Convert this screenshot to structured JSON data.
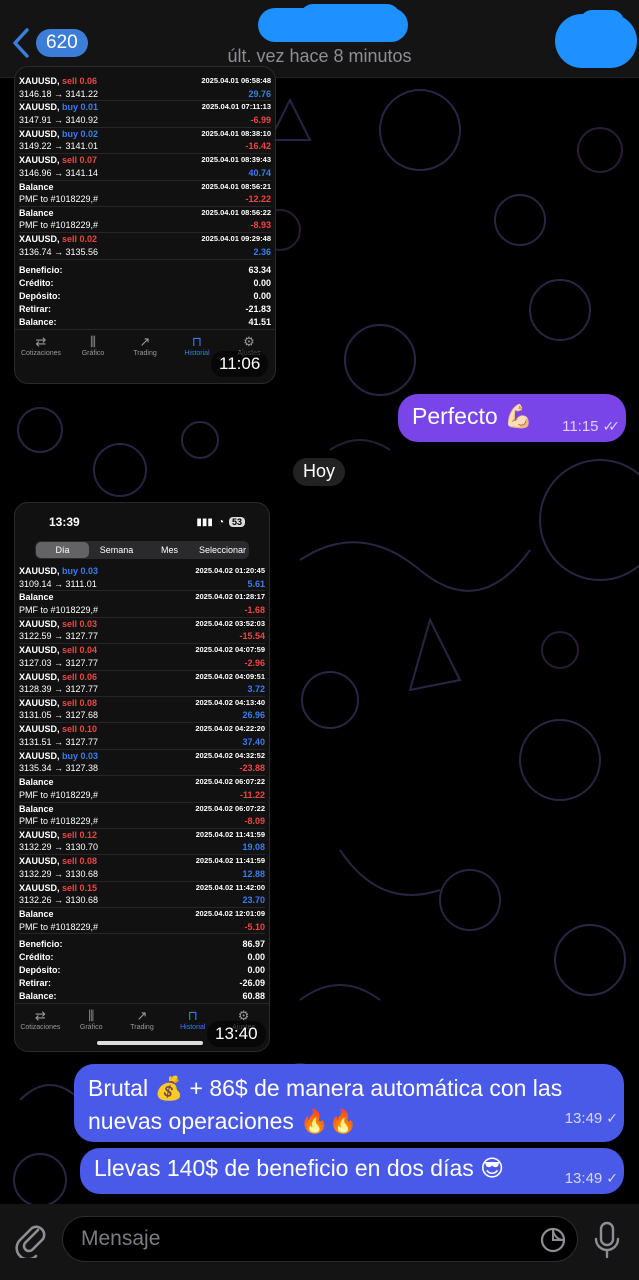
{
  "header": {
    "back_count": "620",
    "status": "últ. vez hace 8 minutos"
  },
  "shot1": {
    "trades": [
      {
        "sym": "XAUUSD,",
        "act": "sell 0.06",
        "type": "sell",
        "time": "2025.04.01 06:58:48",
        "prices": "3146.18 → 3141.22",
        "profit": "29.76"
      },
      {
        "sym": "XAUUSD,",
        "act": "buy 0.01",
        "type": "buy",
        "time": "2025.04.01 07:11:13",
        "prices": "3147.91 → 3140.92",
        "profit": "-6.99"
      },
      {
        "sym": "XAUUSD,",
        "act": "buy 0.02",
        "type": "buy",
        "time": "2025.04.01 08:38:10",
        "prices": "3149.22 → 3141.01",
        "profit": "-16.42"
      },
      {
        "sym": "XAUUSD,",
        "act": "sell 0.07",
        "type": "sell",
        "time": "2025.04.01 08:39:43",
        "prices": "3146.96 → 3141.14",
        "profit": "40.74"
      },
      {
        "sym": "Balance",
        "act": "",
        "type": "",
        "time": "2025.04.01 08:56:21",
        "prices": "PMF to #1018229,#",
        "profit": "-12.22"
      },
      {
        "sym": "Balance",
        "act": "",
        "type": "",
        "time": "2025.04.01 08:56:22",
        "prices": "PMF to #1018229,#",
        "profit": "-8.93"
      },
      {
        "sym": "XAUUSD,",
        "act": "sell 0.02",
        "type": "sell",
        "time": "2025.04.01 09:29:48",
        "prices": "3136.74 → 3135.56",
        "profit": "2.36"
      }
    ],
    "summary": [
      {
        "label": "Beneficio:",
        "value": "63.34"
      },
      {
        "label": "Crédito:",
        "value": "0.00"
      },
      {
        "label": "Depósito:",
        "value": "0.00"
      },
      {
        "label": "Retirar:",
        "value": "-21.83"
      },
      {
        "label": "Balance:",
        "value": "41.51"
      }
    ],
    "time": "11:06"
  },
  "tabs": [
    {
      "label": "Cotizaciones",
      "icon": "swap-arrows-icon"
    },
    {
      "label": "Gráfico",
      "icon": "candles-icon"
    },
    {
      "label": "Trading",
      "icon": "trend-icon"
    },
    {
      "label": "Historial",
      "icon": "inbox-icon"
    },
    {
      "label": "Ajustes",
      "icon": "gear-icon"
    }
  ],
  "perfecto": {
    "text": "Perfecto 💪🏻",
    "time": "11:15"
  },
  "date_divider": "Hoy",
  "shot2": {
    "clock": "13:39",
    "battery": "53",
    "segments": [
      "Día",
      "Semana",
      "Mes",
      "Seleccionar"
    ],
    "trades": [
      {
        "sym": "XAUUSD,",
        "act": "buy 0.03",
        "type": "buy",
        "time": "2025.04.02 01:20:45",
        "prices": "3109.14 → 3111.01",
        "profit": "5.61"
      },
      {
        "sym": "Balance",
        "act": "",
        "type": "",
        "time": "2025.04.02 01:28:17",
        "prices": "PMF to #1018229,#",
        "profit": "-1.68"
      },
      {
        "sym": "XAUUSD,",
        "act": "sell 0.03",
        "type": "sell",
        "time": "2025.04.02 03:52:03",
        "prices": "3122.59 → 3127.77",
        "profit": "-15.54"
      },
      {
        "sym": "XAUUSD,",
        "act": "sell 0.04",
        "type": "sell",
        "time": "2025.04.02 04:07:59",
        "prices": "3127.03 → 3127.77",
        "profit": "-2.96"
      },
      {
        "sym": "XAUUSD,",
        "act": "sell 0.06",
        "type": "sell",
        "time": "2025.04.02 04:09:51",
        "prices": "3128.39 → 3127.77",
        "profit": "3.72"
      },
      {
        "sym": "XAUUSD,",
        "act": "sell 0.08",
        "type": "sell",
        "time": "2025.04.02 04:13:40",
        "prices": "3131.05 → 3127.68",
        "profit": "26.96"
      },
      {
        "sym": "XAUUSD,",
        "act": "sell 0.10",
        "type": "sell",
        "time": "2025.04.02 04:22:20",
        "prices": "3131.51 → 3127.77",
        "profit": "37.40"
      },
      {
        "sym": "XAUUSD,",
        "act": "buy 0.03",
        "type": "buy",
        "time": "2025.04.02 04:32:52",
        "prices": "3135.34 → 3127.38",
        "profit": "-23.88"
      },
      {
        "sym": "Balance",
        "act": "",
        "type": "",
        "time": "2025.04.02 06:07:22",
        "prices": "PMF to #1018229,#",
        "profit": "-11.22"
      },
      {
        "sym": "Balance",
        "act": "",
        "type": "",
        "time": "2025.04.02 06:07:22",
        "prices": "PMF to #1018229,#",
        "profit": "-8.09"
      },
      {
        "sym": "XAUUSD,",
        "act": "sell 0.12",
        "type": "sell",
        "time": "2025.04.02 11:41:59",
        "prices": "3132.29 → 3130.70",
        "profit": "19.08"
      },
      {
        "sym": "XAUUSD,",
        "act": "sell 0.08",
        "type": "sell",
        "time": "2025.04.02 11:41:59",
        "prices": "3132.29 → 3130.68",
        "profit": "12.88"
      },
      {
        "sym": "XAUUSD,",
        "act": "sell 0.15",
        "type": "sell",
        "time": "2025.04.02 11:42:00",
        "prices": "3132.26 → 3130.68",
        "profit": "23.70"
      },
      {
        "sym": "Balance",
        "act": "",
        "type": "",
        "time": "2025.04.02 12:01:09",
        "prices": "PMF to #1018229,#",
        "profit": "-5.10"
      }
    ],
    "summary": [
      {
        "label": "Beneficio:",
        "value": "86.97"
      },
      {
        "label": "Crédito:",
        "value": "0.00"
      },
      {
        "label": "Depósito:",
        "value": "0.00"
      },
      {
        "label": "Retirar:",
        "value": "-26.09"
      },
      {
        "label": "Balance:",
        "value": "60.88"
      }
    ],
    "time": "13:40"
  },
  "brutal": {
    "text": "Brutal 💰 + 86$ de manera automática con las nuevas operaciones 🔥🔥",
    "time": "13:49"
  },
  "llevas": {
    "text": "Llevas 140$ de beneficio en dos días 😎",
    "time": "13:49"
  },
  "input": {
    "placeholder": "Mensaje"
  }
}
